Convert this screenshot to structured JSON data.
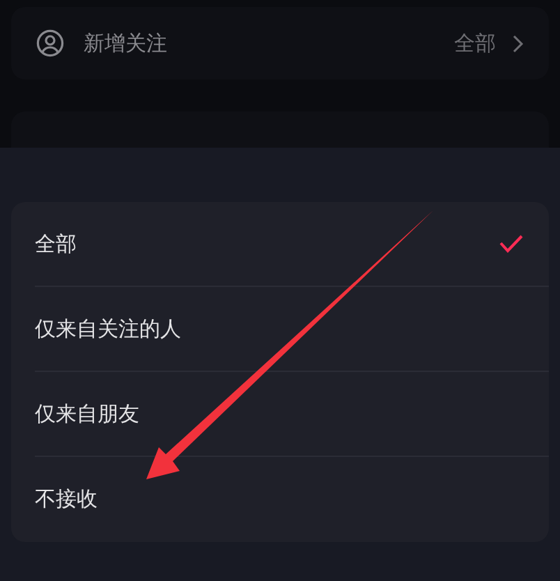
{
  "settings": [
    {
      "label": "新增关注",
      "value": "全部"
    }
  ],
  "sheet": {
    "options": [
      {
        "label": "全部",
        "selected": true
      },
      {
        "label": "仅来自关注的人",
        "selected": false
      },
      {
        "label": "仅来自朋友",
        "selected": false
      },
      {
        "label": "不接收",
        "selected": false
      }
    ]
  }
}
